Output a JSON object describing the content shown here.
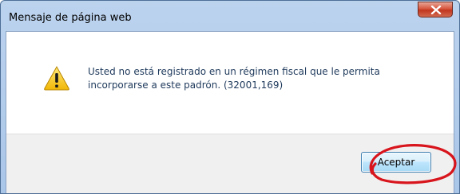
{
  "dialog": {
    "title": "Mensaje de página web",
    "message": "Usted no está registrado en un régimen fiscal que le permita incorporarse a este padrón. (32001,169)",
    "ok_label": "Aceptar",
    "close_icon": "close-icon",
    "warning_icon": "warning-icon"
  },
  "colors": {
    "title_bar": "#bcd3ee",
    "message_text": "#1e395b",
    "close_button": "#c2361e",
    "annotation_circle": "#d8141c"
  }
}
